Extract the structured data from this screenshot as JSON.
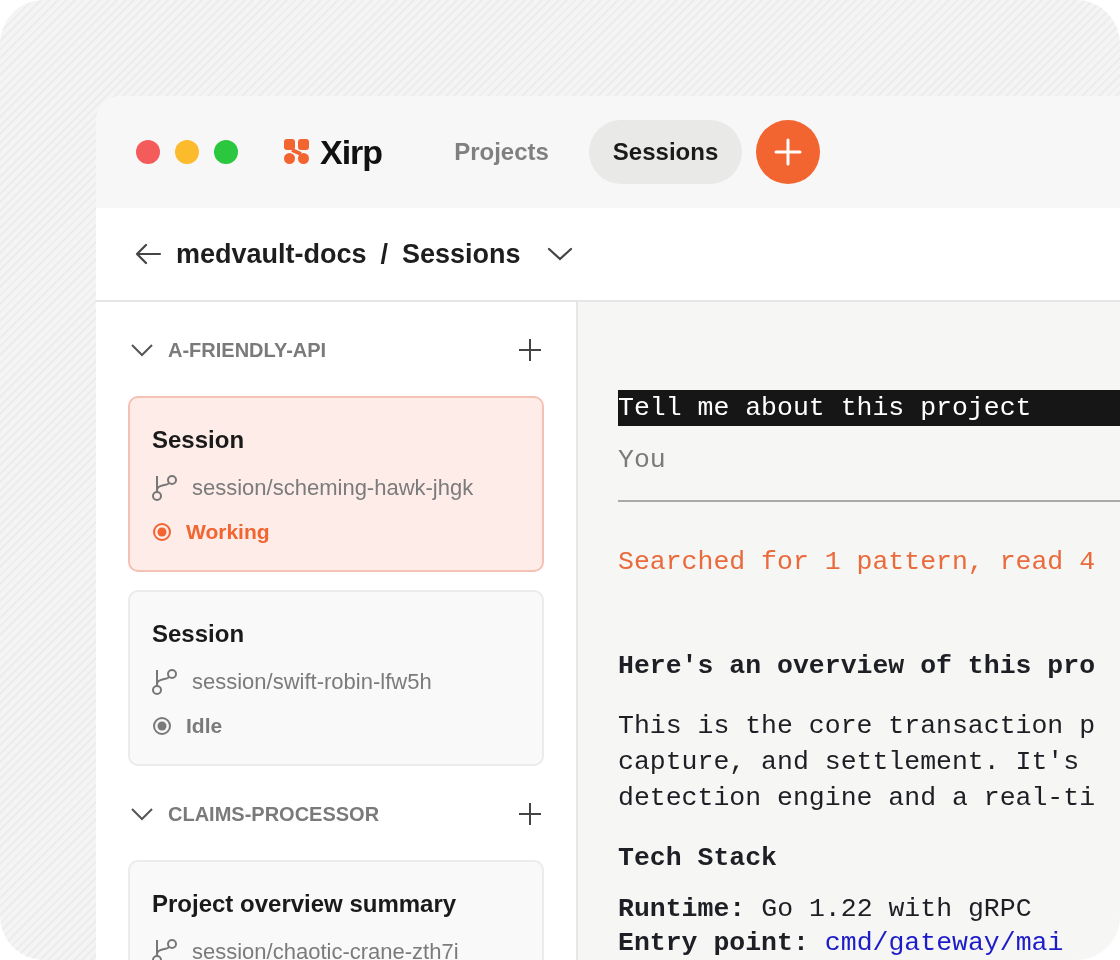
{
  "app": {
    "logo_text": "Xirp"
  },
  "tabs": [
    {
      "label": "Projects",
      "selected": false
    },
    {
      "label": "Sessions",
      "selected": true
    }
  ],
  "breadcrumb": {
    "project": "medvault-docs",
    "separator": "/",
    "page": "Sessions"
  },
  "sidebar": {
    "groups": [
      {
        "name": "A-FRIENDLY-API",
        "expanded": true,
        "sessions": [
          {
            "title": "Session",
            "branch": "session/scheming-hawk-jhgk",
            "selected": true,
            "status": {
              "label": "Working",
              "kind": "working"
            }
          },
          {
            "title": "Session",
            "branch": "session/swift-robin-lfw5h",
            "selected": false,
            "status": {
              "label": "Idle",
              "kind": "idle"
            }
          }
        ]
      },
      {
        "name": "CLAIMS-PROCESSOR",
        "expanded": true,
        "sessions": [
          {
            "title": "Project overview summary",
            "branch": "session/chaotic-crane-zth7i",
            "selected": false
          }
        ]
      }
    ]
  },
  "chat": {
    "user_message": "Tell me about this project",
    "user_label": "You",
    "tool_summary": "Searched for 1 pattern, read 4",
    "heading": "Here's an overview of this pro",
    "paragraph_lines": [
      "This is the core transaction p",
      "capture, and settlement. It's",
      "detection engine and a real-ti"
    ],
    "section_heading": "Tech Stack",
    "facts": [
      {
        "label": "Runtime:",
        "value": "Go 1.22 with gRPC",
        "kind": "text"
      },
      {
        "label": "Entry point:",
        "value": "cmd/gateway/mai",
        "kind": "link"
      }
    ]
  }
}
